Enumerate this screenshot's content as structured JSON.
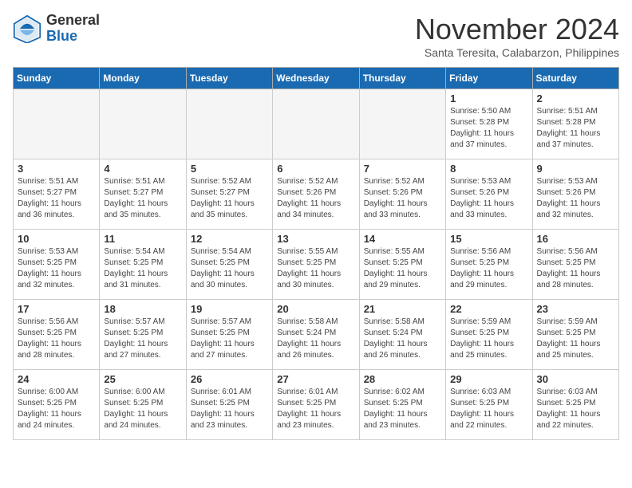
{
  "header": {
    "logo_line1": "General",
    "logo_line2": "Blue",
    "title": "November 2024",
    "subtitle": "Santa Teresita, Calabarzon, Philippines"
  },
  "calendar": {
    "days_of_week": [
      "Sunday",
      "Monday",
      "Tuesday",
      "Wednesday",
      "Thursday",
      "Friday",
      "Saturday"
    ],
    "weeks": [
      [
        {
          "day": "",
          "info": ""
        },
        {
          "day": "",
          "info": ""
        },
        {
          "day": "",
          "info": ""
        },
        {
          "day": "",
          "info": ""
        },
        {
          "day": "",
          "info": ""
        },
        {
          "day": "1",
          "info": "Sunrise: 5:50 AM\nSunset: 5:28 PM\nDaylight: 11 hours\nand 37 minutes."
        },
        {
          "day": "2",
          "info": "Sunrise: 5:51 AM\nSunset: 5:28 PM\nDaylight: 11 hours\nand 37 minutes."
        }
      ],
      [
        {
          "day": "3",
          "info": "Sunrise: 5:51 AM\nSunset: 5:27 PM\nDaylight: 11 hours\nand 36 minutes."
        },
        {
          "day": "4",
          "info": "Sunrise: 5:51 AM\nSunset: 5:27 PM\nDaylight: 11 hours\nand 35 minutes."
        },
        {
          "day": "5",
          "info": "Sunrise: 5:52 AM\nSunset: 5:27 PM\nDaylight: 11 hours\nand 35 minutes."
        },
        {
          "day": "6",
          "info": "Sunrise: 5:52 AM\nSunset: 5:26 PM\nDaylight: 11 hours\nand 34 minutes."
        },
        {
          "day": "7",
          "info": "Sunrise: 5:52 AM\nSunset: 5:26 PM\nDaylight: 11 hours\nand 33 minutes."
        },
        {
          "day": "8",
          "info": "Sunrise: 5:53 AM\nSunset: 5:26 PM\nDaylight: 11 hours\nand 33 minutes."
        },
        {
          "day": "9",
          "info": "Sunrise: 5:53 AM\nSunset: 5:26 PM\nDaylight: 11 hours\nand 32 minutes."
        }
      ],
      [
        {
          "day": "10",
          "info": "Sunrise: 5:53 AM\nSunset: 5:25 PM\nDaylight: 11 hours\nand 32 minutes."
        },
        {
          "day": "11",
          "info": "Sunrise: 5:54 AM\nSunset: 5:25 PM\nDaylight: 11 hours\nand 31 minutes."
        },
        {
          "day": "12",
          "info": "Sunrise: 5:54 AM\nSunset: 5:25 PM\nDaylight: 11 hours\nand 30 minutes."
        },
        {
          "day": "13",
          "info": "Sunrise: 5:55 AM\nSunset: 5:25 PM\nDaylight: 11 hours\nand 30 minutes."
        },
        {
          "day": "14",
          "info": "Sunrise: 5:55 AM\nSunset: 5:25 PM\nDaylight: 11 hours\nand 29 minutes."
        },
        {
          "day": "15",
          "info": "Sunrise: 5:56 AM\nSunset: 5:25 PM\nDaylight: 11 hours\nand 29 minutes."
        },
        {
          "day": "16",
          "info": "Sunrise: 5:56 AM\nSunset: 5:25 PM\nDaylight: 11 hours\nand 28 minutes."
        }
      ],
      [
        {
          "day": "17",
          "info": "Sunrise: 5:56 AM\nSunset: 5:25 PM\nDaylight: 11 hours\nand 28 minutes."
        },
        {
          "day": "18",
          "info": "Sunrise: 5:57 AM\nSunset: 5:25 PM\nDaylight: 11 hours\nand 27 minutes."
        },
        {
          "day": "19",
          "info": "Sunrise: 5:57 AM\nSunset: 5:25 PM\nDaylight: 11 hours\nand 27 minutes."
        },
        {
          "day": "20",
          "info": "Sunrise: 5:58 AM\nSunset: 5:24 PM\nDaylight: 11 hours\nand 26 minutes."
        },
        {
          "day": "21",
          "info": "Sunrise: 5:58 AM\nSunset: 5:24 PM\nDaylight: 11 hours\nand 26 minutes."
        },
        {
          "day": "22",
          "info": "Sunrise: 5:59 AM\nSunset: 5:25 PM\nDaylight: 11 hours\nand 25 minutes."
        },
        {
          "day": "23",
          "info": "Sunrise: 5:59 AM\nSunset: 5:25 PM\nDaylight: 11 hours\nand 25 minutes."
        }
      ],
      [
        {
          "day": "24",
          "info": "Sunrise: 6:00 AM\nSunset: 5:25 PM\nDaylight: 11 hours\nand 24 minutes."
        },
        {
          "day": "25",
          "info": "Sunrise: 6:00 AM\nSunset: 5:25 PM\nDaylight: 11 hours\nand 24 minutes."
        },
        {
          "day": "26",
          "info": "Sunrise: 6:01 AM\nSunset: 5:25 PM\nDaylight: 11 hours\nand 23 minutes."
        },
        {
          "day": "27",
          "info": "Sunrise: 6:01 AM\nSunset: 5:25 PM\nDaylight: 11 hours\nand 23 minutes."
        },
        {
          "day": "28",
          "info": "Sunrise: 6:02 AM\nSunset: 5:25 PM\nDaylight: 11 hours\nand 23 minutes."
        },
        {
          "day": "29",
          "info": "Sunrise: 6:03 AM\nSunset: 5:25 PM\nDaylight: 11 hours\nand 22 minutes."
        },
        {
          "day": "30",
          "info": "Sunrise: 6:03 AM\nSunset: 5:25 PM\nDaylight: 11 hours\nand 22 minutes."
        }
      ]
    ]
  }
}
